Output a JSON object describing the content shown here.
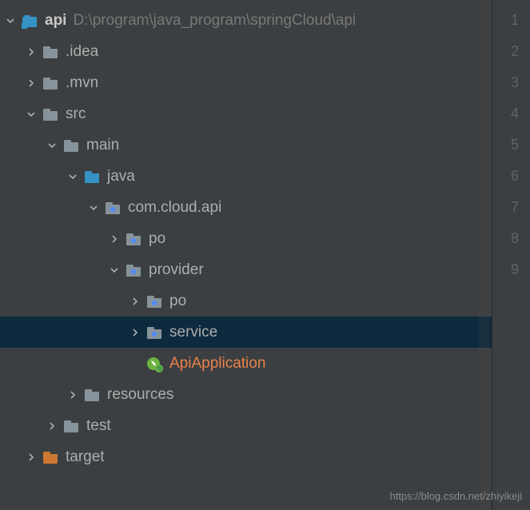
{
  "tree": {
    "root": {
      "name": "api",
      "path": "D:\\program\\java_program\\springCloud\\api"
    },
    "nodes": [
      {
        "label": ".idea",
        "indent": 1,
        "arrow": "right",
        "icon": "folder-gray"
      },
      {
        "label": ".mvn",
        "indent": 1,
        "arrow": "right",
        "icon": "folder-gray"
      },
      {
        "label": "src",
        "indent": 1,
        "arrow": "down",
        "icon": "folder-gray"
      },
      {
        "label": "main",
        "indent": 2,
        "arrow": "down",
        "icon": "folder-gray"
      },
      {
        "label": "java",
        "indent": 3,
        "arrow": "down",
        "icon": "folder-blue"
      },
      {
        "label": "com.cloud.api",
        "indent": 4,
        "arrow": "down",
        "icon": "folder-pkg"
      },
      {
        "label": "po",
        "indent": 5,
        "arrow": "right",
        "icon": "folder-pkg"
      },
      {
        "label": "provider",
        "indent": 5,
        "arrow": "down",
        "icon": "folder-pkg"
      },
      {
        "label": "po",
        "indent": 6,
        "arrow": "right",
        "icon": "folder-pkg"
      },
      {
        "label": "service",
        "indent": 6,
        "arrow": "right",
        "icon": "folder-pkg",
        "selected": true
      },
      {
        "label": "ApiApplication",
        "indent": 6,
        "arrow": "blank",
        "icon": "spring",
        "style": "orange"
      },
      {
        "label": "resources",
        "indent": 3,
        "arrow": "right",
        "icon": "resources"
      },
      {
        "label": "test",
        "indent": 2,
        "arrow": "right",
        "icon": "folder-gray"
      },
      {
        "label": "target",
        "indent": 1,
        "arrow": "right",
        "icon": "folder-orange"
      }
    ]
  },
  "gutter": {
    "lines": [
      "1",
      "2",
      "3",
      "4",
      "5",
      "6",
      "7",
      "8",
      "9"
    ]
  },
  "watermark": "https://blog.csdn.net/zhiyikeji"
}
